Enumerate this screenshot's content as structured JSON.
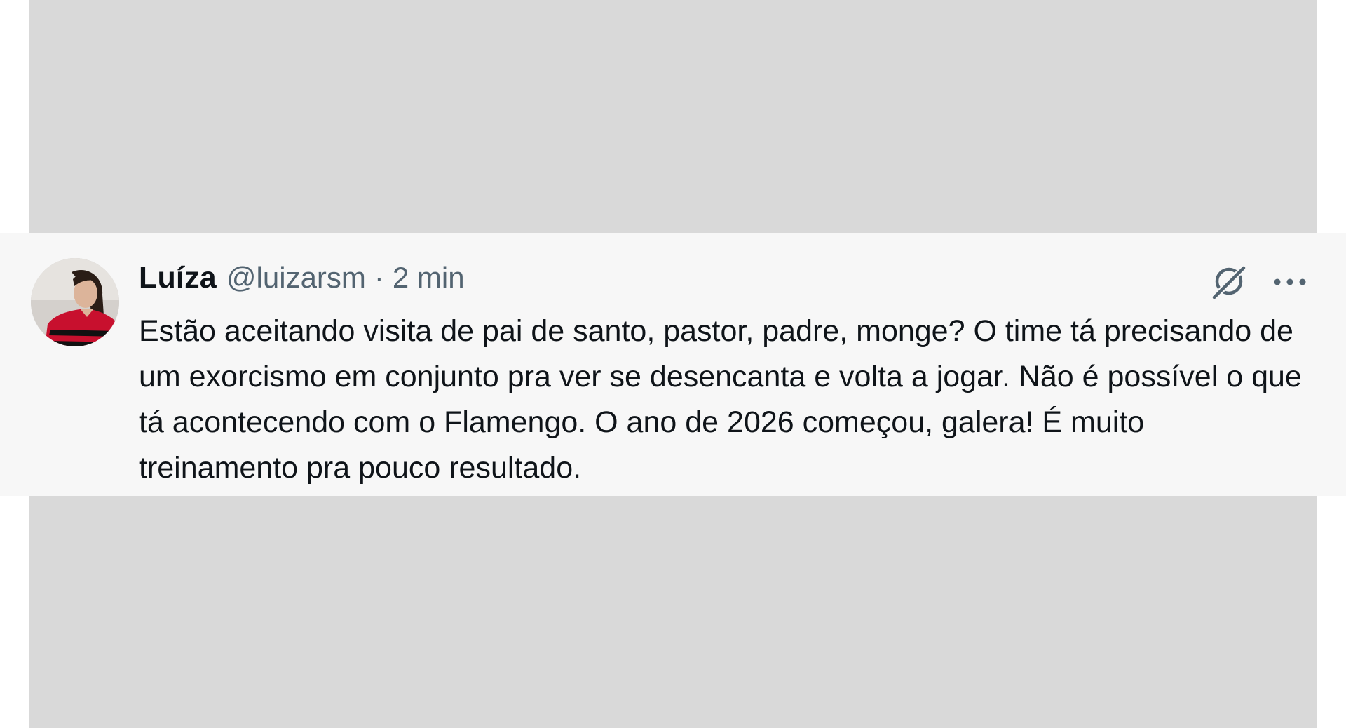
{
  "tweet": {
    "display_name": "Luíza",
    "handle": "@luizarsm",
    "separator": "·",
    "timestamp": "2 min",
    "text": "Estão aceitando visita de pai de santo, pastor, padre, monge? O time tá precisando de um exorcismo em conjunto pra ver se desencanta e volta a jogar. Não é possível o que tá acontecendo com o Flamengo. O ano de 2026 começou, galera! É muito treinamento pra pouco resultado.",
    "icons": {
      "avatar": "avatar-photo",
      "grok": "grok-icon",
      "more": "more-options-icon"
    }
  },
  "colors": {
    "background_panel": "#d9d9d9",
    "tweet_background": "#f7f7f7",
    "primary_text": "#0f1419",
    "secondary_text": "#536471"
  }
}
